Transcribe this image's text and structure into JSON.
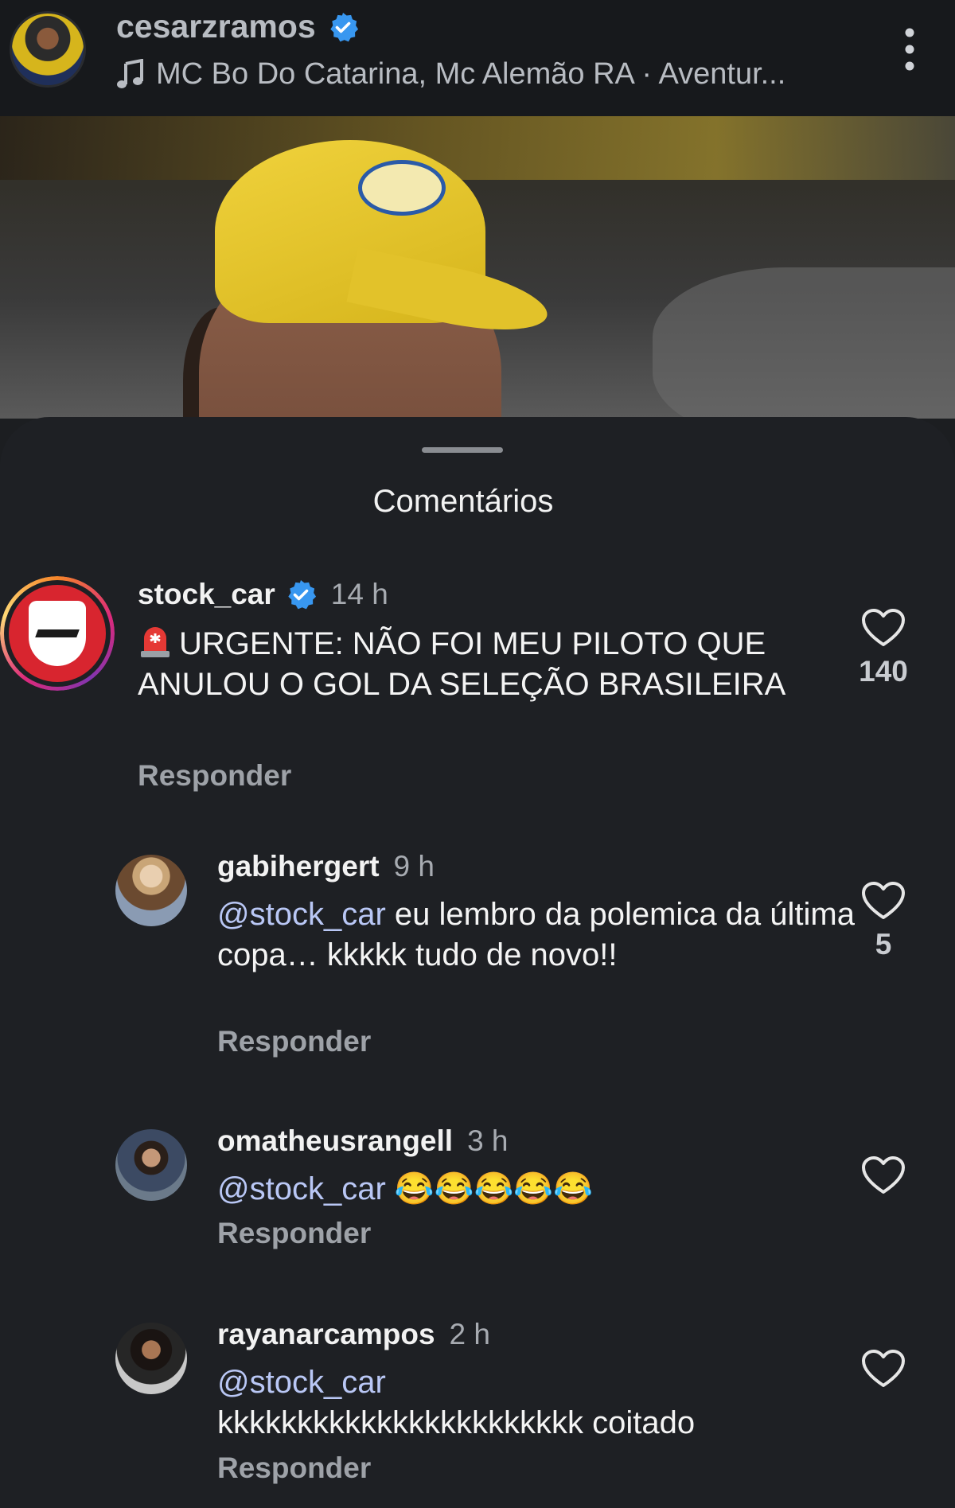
{
  "header": {
    "username": "cesarzramos",
    "music": "MC Bo Do Catarina, Mc Alemão RA · Aventur..."
  },
  "sheet": {
    "title": "Comentários"
  },
  "comments": [
    {
      "username": "stock_car",
      "time": "14 h",
      "text": "URGENTE: NÃO FOI MEU PILOTO QUE ANULOU O GOL DA SELEÇÃO BRASILEIRA",
      "reply": "Responder",
      "likes": "140"
    },
    {
      "username": "gabihergert",
      "time": "9 h",
      "mention": "@stock_car",
      "text": " eu lembro da polemica da última copa… kkkkk tudo de novo!!",
      "reply": "Responder",
      "likes": "5"
    },
    {
      "username": "omatheusrangell",
      "time": "3 h",
      "mention": "@stock_car",
      "emoji": "😂😂😂😂😂",
      "reply": "Responder"
    },
    {
      "username": "rayanarcampos",
      "time": "2 h",
      "mention": "@stock_car",
      "text": "kkkkkkkkkkkkkkkkkkkkkkk coitado",
      "reply": "Responder"
    }
  ]
}
